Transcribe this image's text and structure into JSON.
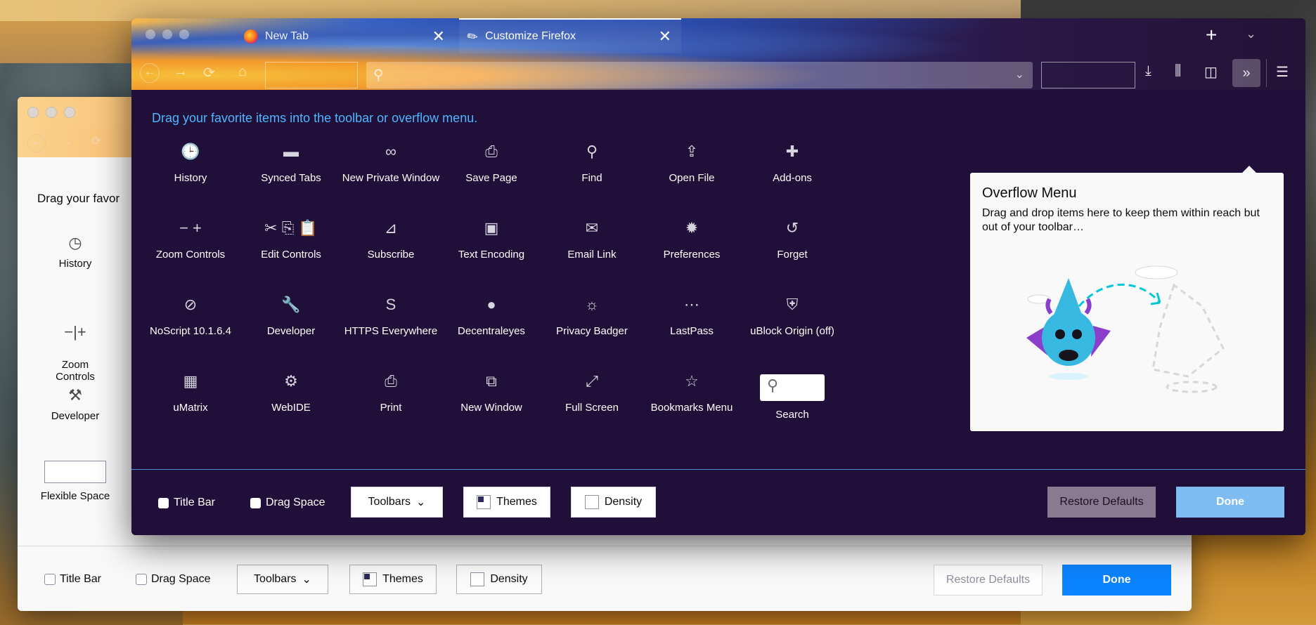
{
  "back_window": {
    "heading": "Drag your favor",
    "items": [
      {
        "icon": "clock-icon",
        "glyph": "🕒",
        "label": "History"
      },
      {
        "icon": "zoom-controls-icon",
        "glyph": "−+",
        "label": "Zoom\nControls"
      },
      {
        "icon": "wrench-icon",
        "glyph": "🔧",
        "label": "Developer"
      },
      {
        "icon": "flexible-space-box",
        "glyph": "",
        "label": "Flexible Space"
      }
    ],
    "footer": {
      "title_bar_label": "Title Bar",
      "drag_space_label": "Drag Space",
      "toolbars_label": "Toolbars",
      "themes_label": "Themes",
      "density_label": "Density",
      "restore_label": "Restore Defaults",
      "done_label": "Done"
    }
  },
  "front_window": {
    "tabs": [
      {
        "title": "New Tab",
        "active": false,
        "close": "✕"
      },
      {
        "title": "Customize Firefox",
        "active": true,
        "close": "✕"
      }
    ],
    "new_tab_glyph": "+",
    "heading": "Drag your favorite items into the toolbar or overflow menu.",
    "palette": [
      {
        "label": "History",
        "icon": "clock-icon",
        "glyph": "🕒"
      },
      {
        "label": "Synced Tabs",
        "icon": "laptop-icon",
        "glyph": "▬"
      },
      {
        "label": "New Private Window",
        "icon": "mask-icon",
        "glyph": "∞"
      },
      {
        "label": "Save Page",
        "icon": "save-page-icon",
        "glyph": "⎙"
      },
      {
        "label": "Find",
        "icon": "search-icon",
        "glyph": "⚲"
      },
      {
        "label": "Open File",
        "icon": "open-file-icon",
        "glyph": "⇪"
      },
      {
        "label": "Add-ons",
        "icon": "puzzle-icon",
        "glyph": "✚"
      },
      {
        "label": "Zoom Controls",
        "icon": "zoom-controls-icon",
        "glyph": "− +"
      },
      {
        "label": "Edit Controls",
        "icon": "edit-controls-icon",
        "glyph": "✂ ⎘ 📋"
      },
      {
        "label": "Subscribe",
        "icon": "rss-icon",
        "glyph": "⊿"
      },
      {
        "label": "Text Encoding",
        "icon": "text-encoding-icon",
        "glyph": "▣"
      },
      {
        "label": "Email Link",
        "icon": "email-icon",
        "glyph": "✉"
      },
      {
        "label": "Preferences",
        "icon": "gear-icon",
        "glyph": "✹"
      },
      {
        "label": "Forget",
        "icon": "forget-icon",
        "glyph": "↺"
      },
      {
        "label": "NoScript 10.1.6.4",
        "icon": "noscript-icon",
        "glyph": "⊘"
      },
      {
        "label": "Developer",
        "icon": "wrench-icon",
        "glyph": "🔧"
      },
      {
        "label": "HTTPS Everywhere",
        "icon": "https-everywhere-icon",
        "glyph": "S"
      },
      {
        "label": "Decentraleyes",
        "icon": "decentraleyes-icon",
        "glyph": "●"
      },
      {
        "label": "Privacy Badger",
        "icon": "privacy-badger-icon",
        "glyph": "☼"
      },
      {
        "label": "LastPass",
        "icon": "lastpass-icon",
        "glyph": "⋯"
      },
      {
        "label": "uBlock Origin (off)",
        "icon": "ublock-icon",
        "glyph": "⛨"
      },
      {
        "label": "uMatrix",
        "icon": "umatrix-icon",
        "glyph": "▦"
      },
      {
        "label": "WebIDE",
        "icon": "webide-icon",
        "glyph": "⚙"
      },
      {
        "label": "Print",
        "icon": "printer-icon",
        "glyph": "⎙"
      },
      {
        "label": "New Window",
        "icon": "new-window-icon",
        "glyph": "⧉"
      },
      {
        "label": "Full Screen",
        "icon": "fullscreen-icon",
        "glyph": "⤢"
      },
      {
        "label": "Bookmarks Menu",
        "icon": "bookmarks-menu-icon",
        "glyph": "☆"
      },
      {
        "label": "Search",
        "icon": "search-icon",
        "glyph": "⚲"
      }
    ],
    "overflow_panel": {
      "title": "Overflow Menu",
      "description": "Drag and drop items here to keep them within reach but out of your toolbar…"
    },
    "footer": {
      "title_bar_label": "Title Bar",
      "drag_space_label": "Drag Space",
      "toolbars_label": "Toolbars",
      "themes_label": "Themes",
      "density_label": "Density",
      "restore_label": "Restore Defaults",
      "done_label": "Done"
    }
  },
  "colors": {
    "front_bg": "#200f38",
    "heading_blue": "#4fb6ff",
    "done_blue": "#0a84ff",
    "done_disabled": "#7fbcf2"
  }
}
